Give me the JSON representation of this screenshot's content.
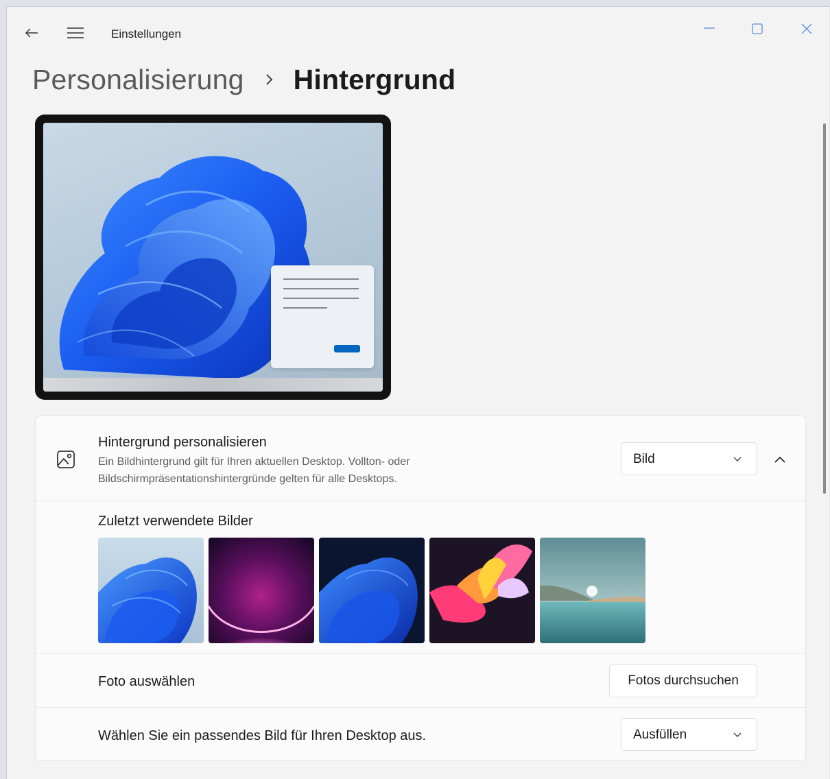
{
  "window": {
    "title": "Einstellungen",
    "controls": {
      "minimize": "minimize-icon",
      "maximize": "maximize-icon",
      "close": "close-icon"
    }
  },
  "breadcrumb": {
    "parent": "Personalisierung",
    "current": "Hintergrund"
  },
  "background": {
    "title": "Hintergrund personalisieren",
    "description": "Ein Bildhintergrund gilt für Ihren aktuellen Desktop. Vollton- oder Bildschirmpräsentationshintergründe gelten für alle Desktops.",
    "type_selected": "Bild"
  },
  "recent": {
    "title": "Zuletzt verwendete Bilder",
    "images": [
      "bloom-light",
      "purple-glow",
      "bloom-dark",
      "ribbon-colorful",
      "lake-landscape"
    ]
  },
  "photo": {
    "label": "Foto auswählen",
    "button": "Fotos durchsuchen"
  },
  "fit": {
    "label": "Wählen Sie ein passendes Bild für Ihren Desktop aus.",
    "selected": "Ausfüllen"
  },
  "colors": {
    "window_bg": "#f3f3f3",
    "card_bg": "#fbfbfb",
    "accent": "#0067c0",
    "bloom_blue": "#1a5cf0"
  }
}
